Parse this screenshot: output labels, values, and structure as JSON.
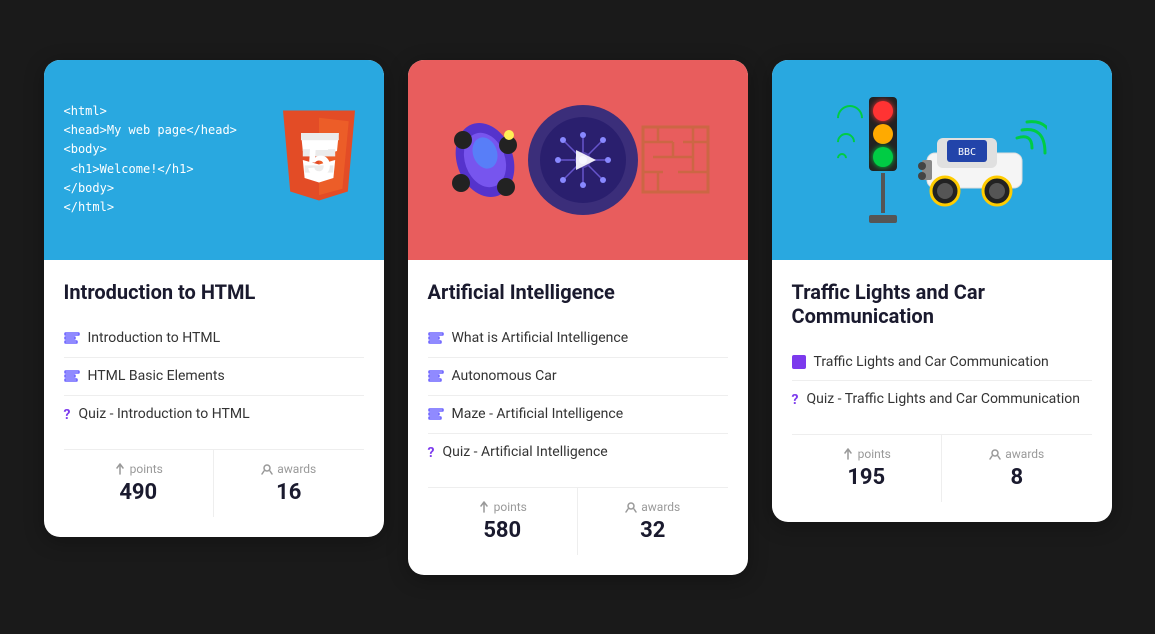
{
  "cards": [
    {
      "id": "html",
      "title": "Introduction to HTML",
      "lessons": [
        {
          "type": "module",
          "text": "Introduction to HTML"
        },
        {
          "type": "module",
          "text": "HTML Basic Elements"
        },
        {
          "type": "quiz",
          "text": "Quiz - Introduction to HTML"
        }
      ],
      "points": 490,
      "awards": 16,
      "points_label": "points",
      "awards_label": "awards"
    },
    {
      "id": "ai",
      "title": "Artificial Intelligence",
      "lessons": [
        {
          "type": "module",
          "text": "What is Artificial Intelligence"
        },
        {
          "type": "module",
          "text": "Autonomous Car"
        },
        {
          "type": "module",
          "text": "Maze - Artificial Intelligence"
        },
        {
          "type": "quiz",
          "text": "Quiz - Artificial Intelligence"
        }
      ],
      "points": 580,
      "awards": 32,
      "points_label": "points",
      "awards_label": "awards"
    },
    {
      "id": "traffic",
      "title": "Traffic Lights and Car Communication",
      "lessons": [
        {
          "type": "module-purple",
          "text": "Traffic Lights and Car Communication"
        },
        {
          "type": "quiz",
          "text": "Quiz - Traffic Lights and Car Communication"
        }
      ],
      "points": 195,
      "awards": 8,
      "points_label": "points",
      "awards_label": "awards"
    }
  ]
}
